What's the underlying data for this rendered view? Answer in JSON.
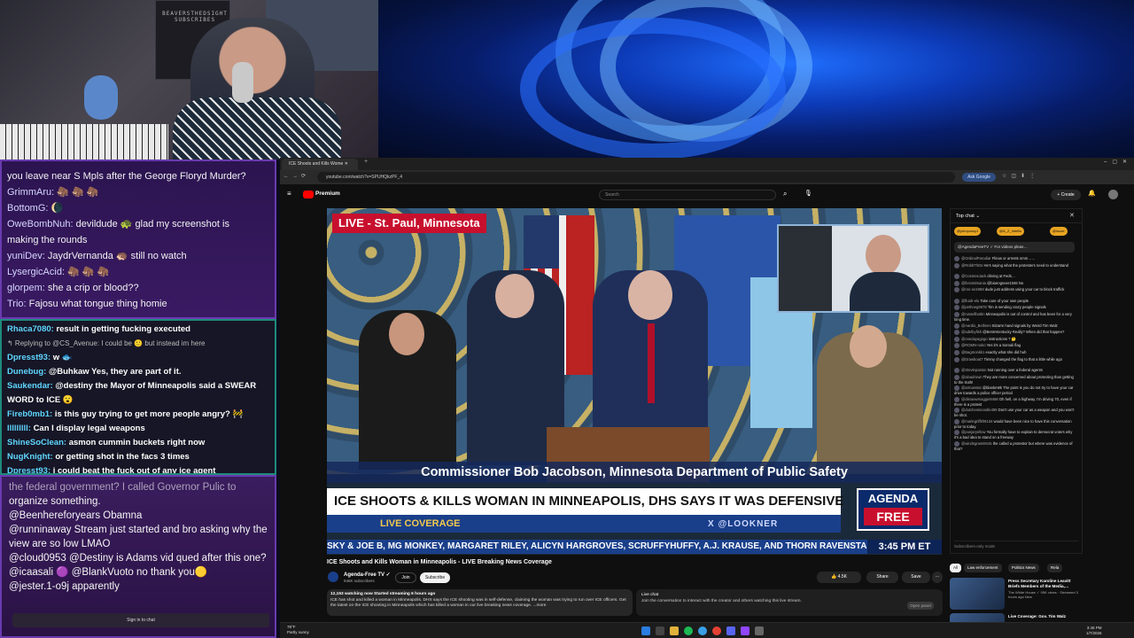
{
  "webcam": {
    "sign_text": "BEAVERSTHEDSIGHT SUBSCRIBES"
  },
  "chat_a": [
    {
      "user": "",
      "text": "you leave near S Mpls after the George Floryd Murder?"
    },
    {
      "user": "GrimmAru:",
      "text": "🦣 🦣 🦣"
    },
    {
      "user": "BottomG:",
      "text": "🌘"
    },
    {
      "user": "OweBombNuh:",
      "text": "devildude 🐢 glad my screenshot is"
    },
    {
      "user": "",
      "text": "making the rounds"
    },
    {
      "user": "yuniDev:",
      "text": "JaydrVernanda 🦔 still no watch"
    },
    {
      "user": "LysergicAcid:",
      "text": "🦣 🦣 🦣"
    },
    {
      "user": "glorpem:",
      "text": "she a crip or blood??"
    },
    {
      "user": "Trio:",
      "text": "Fajosu what tongue thing homie"
    }
  ],
  "chat_b": [
    {
      "user": "Rhaca7080:",
      "text": "result in getting fucking executed",
      "reply": ""
    },
    {
      "user": "",
      "text": "",
      "reply": "↰ Replying to @CS_Avenue: I could be 🙂 but instead im here"
    },
    {
      "user": "Dpresst93:",
      "text": "w 🐟",
      "reply": ""
    },
    {
      "user": "Dunebug:",
      "text": "@Buhkaw Yes, they are part of it.",
      "reply": ""
    },
    {
      "user": "Saukendar:",
      "text": "@destiny the Mayor of Minneapolis said a SWEAR",
      "reply": ""
    },
    {
      "user": "",
      "text": "WORD to ICE 😮",
      "reply": ""
    },
    {
      "user": "Fireb0mb1:",
      "text": "is this guy trying to get more people angry? 🚧",
      "reply": ""
    },
    {
      "user": "lllllllll:",
      "text": "Can I display legal weapons",
      "reply": ""
    },
    {
      "user": "ShineSoClean:",
      "text": "asmon cummin buckets right now",
      "reply": ""
    },
    {
      "user": "NugKnight:",
      "text": "or getting shot in the facs 3 times",
      "reply": ""
    },
    {
      "user": "Dpresst93:",
      "text": "i could beat the fuck out of any ice agent",
      "reply": ""
    }
  ],
  "chat_c": {
    "lines": [
      "the federal government? I called Governor Pulic to",
      "organize something.",
      "@Beenhereforyears Obamna",
      "@runninaway Stream just started and bro asking why the view are so low LMAO",
      "@cloud0953 @Destiny is Adams vid qued after this one?",
      "@icaasali 🟣 @BlankVuoto no thank you🟡",
      "@jester.1-o9j apparently"
    ],
    "signin": "Sign in to chat"
  },
  "browser": {
    "tab_title": "ICE Shoots and Kills Wome",
    "url": "youtube.com/watch?v=SPUHQkzPF_4",
    "ask_google": "Ask Google"
  },
  "youtube": {
    "brand": "Premium",
    "search_placeholder": "Search",
    "create": "+ Create"
  },
  "player": {
    "live_banner": "LIVE - St. Paul, Minnesota",
    "name_bar": "Commissioner Bob Jacobson, Minnesota Department of Public Safety",
    "headline": "ICE SHOOTS & KILLS WOMAN IN MINNEAPOLIS, DHS SAYS IT WAS DEFENSIVE",
    "live_coverage": "LIVE COVERAGE",
    "lookner": "X @LOOKNER",
    "agenda_top": "AGENDA",
    "agenda_bottom": "FREE",
    "ticker": "SKY & JOE B, MG MONKEY, MARGARET RILEY, ALICYN HARGROVES, SCRUFFYHUFFY, A.J. KRAUSE, AND THORN RAVENSTAR!",
    "ticker_time": "3:45 PM ET"
  },
  "video": {
    "title": "ICE Shoots and Kills Woman in Minneapolis - LIVE Breaking News Coverage",
    "channel": "Agenda-Free TV ✓",
    "subs": "946K subscribers",
    "join": "Join",
    "subscribe": "Subscribe",
    "likes": "👍 4.5K",
    "share": "Share",
    "save": "Save",
    "more": "···",
    "desc_meta": "12,153 watching now  Started streaming 6 hours ago",
    "desc_text": "ICE has shot and killed a woman in Minneapolis. DHS says the ICE shooting was in self-defense, claiming the woman was trying to run over ICE officers. Get the latest on the ICE shooting in Minneapolis which has killed a woman in our live breaking news coverage.  ...more"
  },
  "live_chat_box": {
    "title": "Live chat",
    "text": "Join the conversation to interact with the creator and others watching this live stream.",
    "open_panel": "Open panel"
  },
  "ytchat": {
    "header": "Top chat ⌄",
    "close": "✕",
    "chips": [
      "@johnpossy1",
      "@A_Z_Intellis",
      "@louze"
    ],
    "pinned": "@AgendaFreeTV ✓   For videos pleas…",
    "messages": [
      {
        "user": "@OrdinalParodiar",
        "text": "Flinas or arrests omm……"
      },
      {
        "user": "@RobbThDs",
        "text": "He's saying what the protesters need to understand"
      },
      {
        "user": "@CosmosJack",
        "text": "driving at Feds…"
      },
      {
        "user": "@fierostimania",
        "text": "@bioengneer1046 No"
      },
      {
        "user": "@roo-oo1968",
        "text": "dude just address using your car to block traffick"
      },
      {
        "user": "@fluidr-elu",
        "text": "Take care of your own people"
      },
      {
        "user": "@pethoeg9678",
        "text": "Tim is sending crazy people signals"
      },
      {
        "user": "@russellbottin",
        "text": "Minneapolis is out of control and has been for a very long time."
      },
      {
        "user": "@Aardio_Bellmen",
        "text": "Bizarre hand signals by Weird Tim Walz"
      },
      {
        "user": "@adelbyfish",
        "text": "@BenInKentucky Really? When did that happen?"
      },
      {
        "user": "@onedayagogo",
        "text": "instructions ? 🤔"
      },
      {
        "user": "@ROMN-noko",
        "text": "Yes it's a Somali flag"
      },
      {
        "user": "@Bagmonkk1",
        "text": "exactly what she did huh"
      },
      {
        "user": "@Drawboat7",
        "text": "Timmy changed the flag to that a little while ago"
      },
      {
        "user": "@Stevlepaston",
        "text": "Not running over a federal agents"
      },
      {
        "user": "@aloadrown",
        "text": "They are more concerned about protecting than getting to the truth!"
      },
      {
        "user": "@armasstat",
        "text": "@blankm8k The point is you do not try to have your car drive towards a police officer period"
      },
      {
        "user": "@disraewmaggie9468",
        "text": "Oh hell, on a highway. I'm driving 70, even if there is a protest"
      },
      {
        "user": "@dutchessnoodle498",
        "text": "Don't use your car as a weapon and you won't be shot."
      },
      {
        "user": "@marlegriffith9134",
        "text": "would have been nice to have this conversation prior to today."
      },
      {
        "user": "@punjaryellow",
        "text": "You formally have to explain to democrat voters why it's a bad idea to stand on a freeway"
      },
      {
        "user": "@windsgrass9415",
        "text": "the called a protestor but where was evidence of that?"
      }
    ],
    "input": "Subscribers-only mode"
  },
  "rec_tabs": [
    "All",
    "Law enforcement",
    "Politics News",
    "Rela"
  ],
  "recs": [
    {
      "title": "Press Secretary Karoline Leavitt Briefs Members of the Media,…",
      "meta": "The White House ✓  95K views · Streamed 3 hours ago  New"
    },
    {
      "title": "Live Coverage: Gov. Tim Walz",
      "meta": ""
    }
  ],
  "taskbar": {
    "weather_temp": "78°F",
    "weather_desc": "Partly sunny",
    "time": "3:46 PM",
    "date": "1/7/2026"
  }
}
